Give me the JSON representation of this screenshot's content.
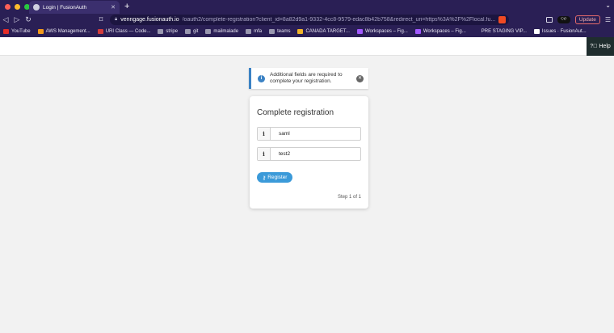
{
  "browser": {
    "tab_title": "Login | FusionAuth",
    "url_host": "venngage.fusionauth.io",
    "url_path": "/oauth2/complete-registration?client_id=8a82d9a1-9332-4cc8-9579-edac8b42b758&redirect_uri=https%3A%2F%2Flocal.fu...",
    "update_label": "Update",
    "bookmarks": [
      {
        "label": "YouTube",
        "color": "#e52d27"
      },
      {
        "label": "AWS Management...",
        "color": "#f29a1b"
      },
      {
        "label": "URI Class — Code...",
        "color": "#d23c3c"
      },
      {
        "label": "stripe",
        "color": "#9a98b0"
      },
      {
        "label": "git",
        "color": "#9a98b0"
      },
      {
        "label": "mailmalade",
        "color": "#9a98b0"
      },
      {
        "label": "mfa",
        "color": "#9a98b0"
      },
      {
        "label": "teams",
        "color": "#9a98b0"
      },
      {
        "label": "CANADA TARGET...",
        "color": "#f0b429"
      },
      {
        "label": "Workspaces – Fig...",
        "color": "#a259ff"
      },
      {
        "label": "Workspaces – Fig...",
        "color": "#a259ff"
      },
      {
        "label": "PRE STAGING VIP...",
        "color": "#2a1f55"
      },
      {
        "label": "Issues · FusionAut...",
        "color": "#ffffff"
      }
    ]
  },
  "header": {
    "help_label": "Help"
  },
  "alert": {
    "message": "Additional fields are required to complete your registration."
  },
  "form": {
    "title": "Complete registration",
    "field1_value": "saml",
    "field2_value": "test2",
    "register_label": "Register",
    "step_text": "Step 1 of 1"
  }
}
